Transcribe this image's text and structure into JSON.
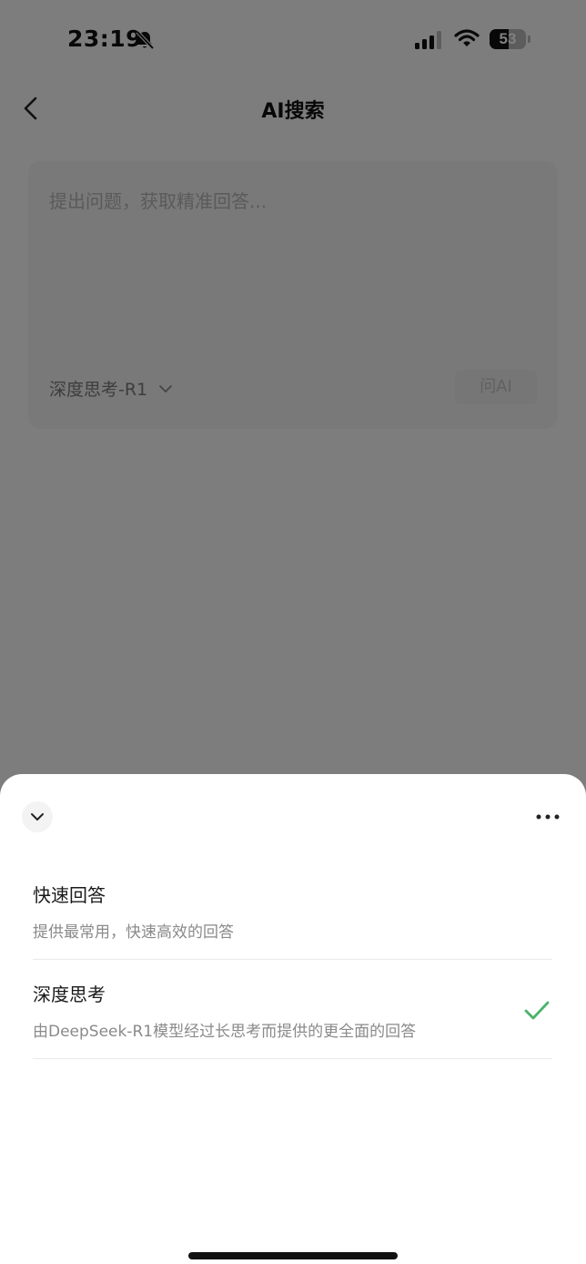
{
  "status_bar": {
    "time": "23:19",
    "battery": "53",
    "battery_level": 0.53,
    "icons": [
      "bell-off-icon",
      "cellular-signal-icon",
      "wifi-icon",
      "battery-icon"
    ]
  },
  "nav": {
    "title": "AI搜索",
    "back_icon": "chevron-left-icon"
  },
  "input": {
    "placeholder": "提出问题，获取精准回答...",
    "model_label": "深度思考-R1",
    "ask_button": "问AI"
  },
  "sheet": {
    "collapse_icon": "chevron-down-icon",
    "more_icon": "more-horizontal-icon",
    "options": [
      {
        "title": "快速回答",
        "description": "提供最常用，快速高效的回答",
        "selected": false
      },
      {
        "title": "深度思考",
        "description": "由DeepSeek-R1模型经过长思考而提供的更全面的回答",
        "selected": true
      }
    ]
  },
  "colors": {
    "check": "#4bb36b",
    "overlay": "rgba(0,0,0,0.5)"
  }
}
